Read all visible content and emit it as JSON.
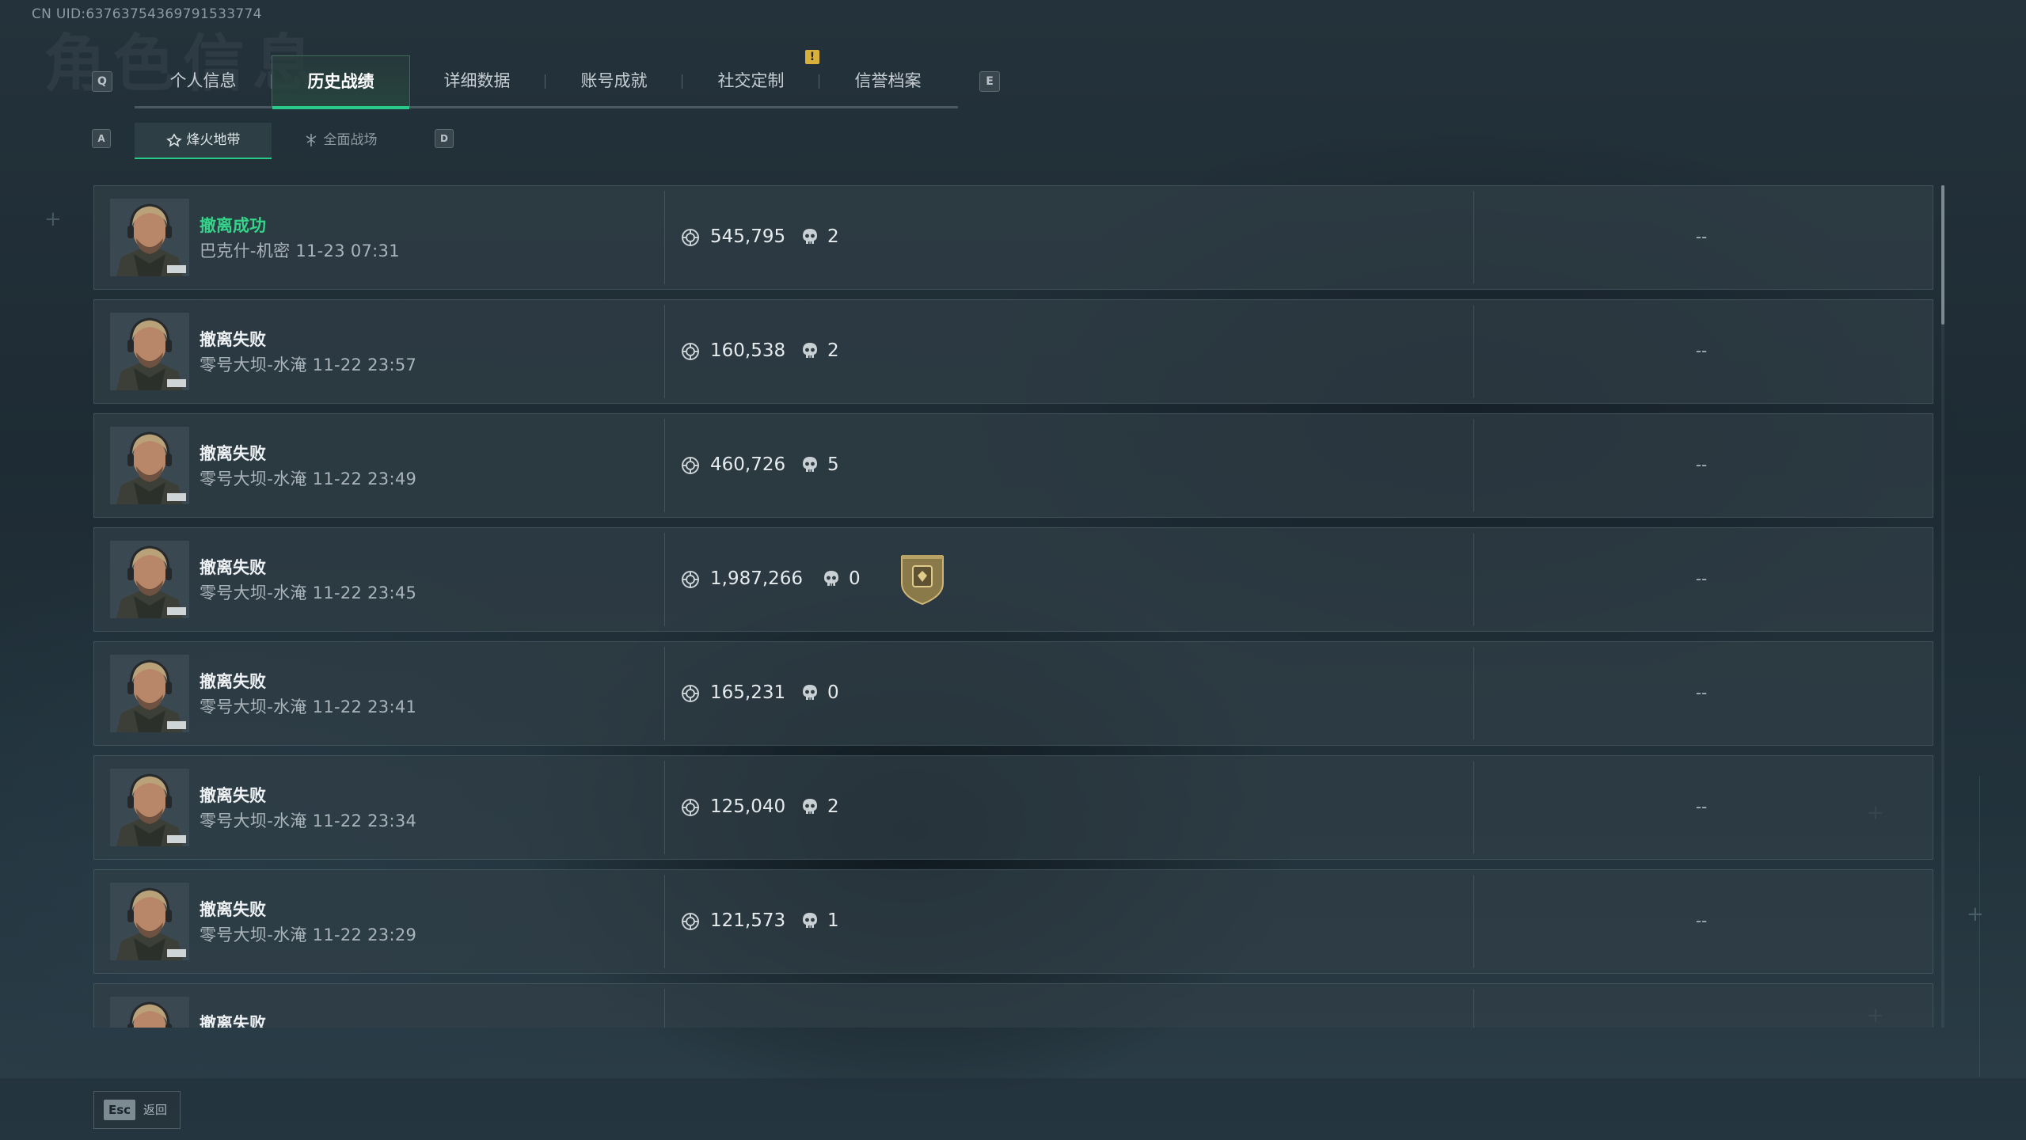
{
  "uid_text": "CN UID:6376375436979153​3774",
  "ghost_title": "角色信息",
  "nav": {
    "prev_key": "Q",
    "next_key": "E",
    "tabs": [
      {
        "label": "个人信息",
        "active": false
      },
      {
        "label": "历史战绩",
        "active": true
      },
      {
        "label": "详细数据",
        "active": false
      },
      {
        "label": "账号成就",
        "active": false
      },
      {
        "label": "社交定制",
        "active": false,
        "badge": "!"
      },
      {
        "label": "信誉档案",
        "active": false
      }
    ]
  },
  "mode_nav": {
    "prev_key": "A",
    "next_key": "D",
    "tabs": [
      {
        "label": "烽火地带",
        "icon": "extraction-mode-icon",
        "active": true
      },
      {
        "label": "全面战场",
        "icon": "warfare-mode-icon",
        "active": false
      }
    ]
  },
  "matches": [
    {
      "status": "撤离成功",
      "result": "success",
      "map_time": "巴克什-机密 11-23 07:31",
      "value": "545,795",
      "kills": "2",
      "medal": false,
      "extra": "--"
    },
    {
      "status": "撤离失败",
      "result": "fail",
      "map_time": "零号大坝-水淹 11-22 23:57",
      "value": "160,538",
      "kills": "2",
      "medal": false,
      "extra": "--"
    },
    {
      "status": "撤离失败",
      "result": "fail",
      "map_time": "零号大坝-水淹 11-22 23:49",
      "value": "460,726",
      "kills": "5",
      "medal": false,
      "extra": "--"
    },
    {
      "status": "撤离失败",
      "result": "fail",
      "map_time": "零号大坝-水淹 11-22 23:45",
      "value": "1,987,266",
      "kills": "0",
      "medal": true,
      "extra": "--"
    },
    {
      "status": "撤离失败",
      "result": "fail",
      "map_time": "零号大坝-水淹 11-22 23:41",
      "value": "165,231",
      "kills": "0",
      "medal": false,
      "extra": "--"
    },
    {
      "status": "撤离失败",
      "result": "fail",
      "map_time": "零号大坝-水淹 11-22 23:34",
      "value": "125,040",
      "kills": "2",
      "medal": false,
      "extra": "--"
    },
    {
      "status": "撤离失败",
      "result": "fail",
      "map_time": "零号大坝-水淹 11-22 23:29",
      "value": "121,573",
      "kills": "1",
      "medal": false,
      "extra": "--"
    },
    {
      "status": "撤离失败",
      "result": "fail",
      "map_time": "",
      "value": "",
      "kills": "",
      "medal": false,
      "extra": ""
    }
  ],
  "footer": {
    "esc_key": "Esc",
    "esc_label": "返回"
  },
  "colors": {
    "accent": "#29c98a",
    "success": "#35d48a",
    "badge": "#d8b03a"
  }
}
